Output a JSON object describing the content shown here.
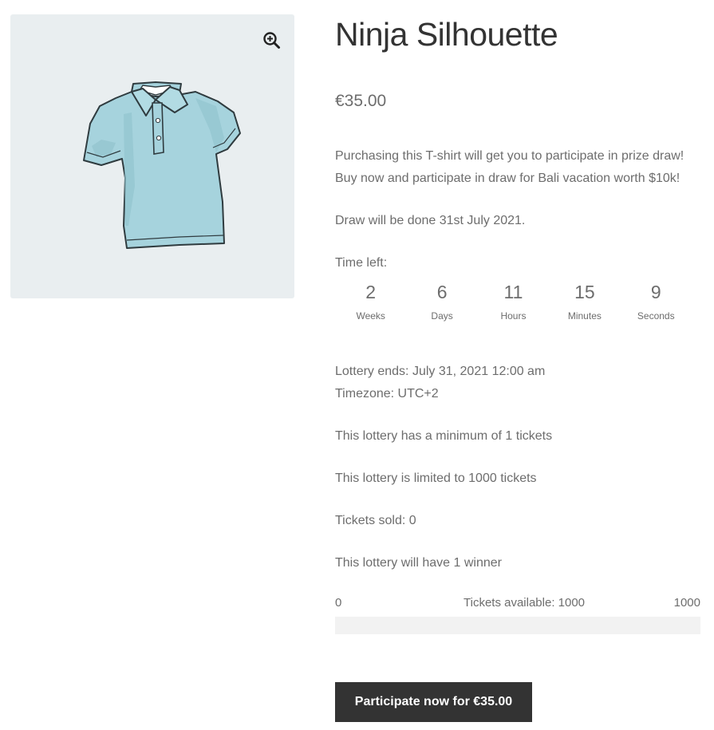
{
  "product": {
    "title": "Ninja Silhouette",
    "price": "€35.00",
    "description_line1": "Purchasing this T-shirt will get you to participate in prize draw!",
    "description_line2": "Buy now and participate in draw for Bali vacation worth $10k!",
    "draw_date": "Draw will be done 31st July 2021.",
    "image_icon": "polo-shirt-image",
    "zoom_icon": "zoom-in-icon"
  },
  "countdown": {
    "label": "Time left:",
    "units": [
      {
        "value": "2",
        "label": "Weeks"
      },
      {
        "value": "6",
        "label": "Days"
      },
      {
        "value": "11",
        "label": "Hours"
      },
      {
        "value": "15",
        "label": "Minutes"
      },
      {
        "value": "9",
        "label": "Seconds"
      }
    ]
  },
  "lottery": {
    "ends": "Lottery ends: July 31, 2021 12:00 am",
    "timezone": "Timezone: UTC+2",
    "minimum": "This lottery has a minimum of 1 tickets",
    "limit": "This lottery is limited to 1000 tickets",
    "sold": "Tickets sold: 0",
    "winners": "This lottery will have 1 winner"
  },
  "progress": {
    "min_label": "0",
    "max_label": "1000",
    "available_label": "Tickets available: 1000",
    "sold_fraction": 0
  },
  "actions": {
    "participate_label": "Participate now for €35.00"
  },
  "colors": {
    "gallery_bg": "#e9eef0",
    "button_bg": "#333333",
    "text": "#6d6d6d",
    "title": "#333333"
  }
}
